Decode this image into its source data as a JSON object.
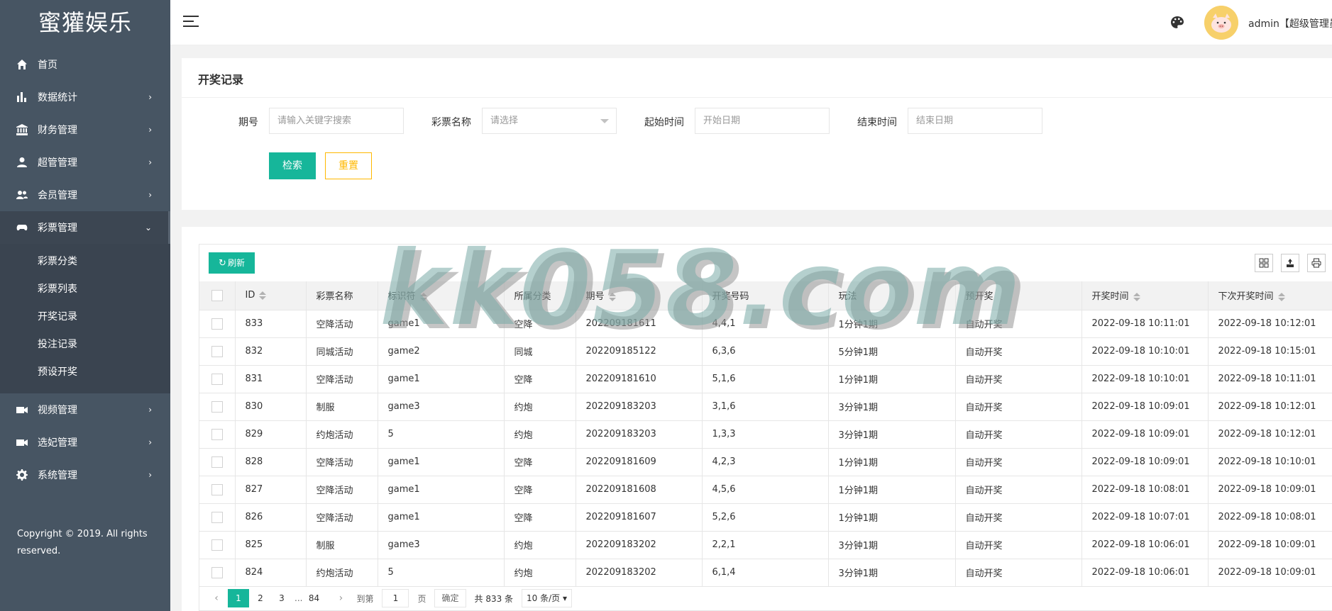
{
  "app": {
    "title": "蜜獾娱乐",
    "copyright": "Copyright © 2019. All rights reserved."
  },
  "sidebar": {
    "items": [
      {
        "label": "首页",
        "icon": "home-icon"
      },
      {
        "label": "数据统计",
        "icon": "bar-chart-icon"
      },
      {
        "label": "财务管理",
        "icon": "bank-icon"
      },
      {
        "label": "超管管理",
        "icon": "user-icon"
      },
      {
        "label": "会员管理",
        "icon": "users-icon"
      },
      {
        "label": "彩票管理",
        "icon": "gamepad-icon"
      },
      {
        "label": "视频管理",
        "icon": "video-icon"
      },
      {
        "label": "选妃管理",
        "icon": "video-icon"
      },
      {
        "label": "系统管理",
        "icon": "gear-icon"
      }
    ],
    "submenu": [
      "彩票分类",
      "彩票列表",
      "开奖记录",
      "投注记录",
      "预设开奖"
    ]
  },
  "header": {
    "user": "admin【超级管理员"
  },
  "filter": {
    "title": "开奖记录",
    "period_label": "期号",
    "period_placeholder": "请输入关键字搜索",
    "lottery_label": "彩票名称",
    "lottery_placeholder": "请选择",
    "start_label": "起始时间",
    "start_placeholder": "开始日期",
    "end_label": "结束时间",
    "end_placeholder": "结束日期",
    "search_btn": "检索",
    "reset_btn": "重置"
  },
  "table": {
    "refresh_btn": "刷新",
    "columns": [
      "ID",
      "彩票名称",
      "标识符",
      "所属分类",
      "期号",
      "开奖号码",
      "玩法",
      "预开奖",
      "开奖时间",
      "下次开奖时间"
    ],
    "rows": [
      [
        "833",
        "空降活动",
        "game1",
        "空降",
        "202209181611",
        "4,4,1",
        "1分钟1期",
        "自动开奖",
        "2022-09-18 10:11:01",
        "2022-09-18 10:12:01"
      ],
      [
        "832",
        "同城活动",
        "game2",
        "同城",
        "202209185122",
        "6,3,6",
        "5分钟1期",
        "自动开奖",
        "2022-09-18 10:10:01",
        "2022-09-18 10:15:01"
      ],
      [
        "831",
        "空降活动",
        "game1",
        "空降",
        "202209181610",
        "5,1,6",
        "1分钟1期",
        "自动开奖",
        "2022-09-18 10:10:01",
        "2022-09-18 10:11:01"
      ],
      [
        "830",
        "制服",
        "game3",
        "约炮",
        "202209183203",
        "3,1,6",
        "3分钟1期",
        "自动开奖",
        "2022-09-18 10:09:01",
        "2022-09-18 10:12:01"
      ],
      [
        "829",
        "约炮活动",
        "5",
        "约炮",
        "202209183203",
        "1,3,3",
        "3分钟1期",
        "自动开奖",
        "2022-09-18 10:09:01",
        "2022-09-18 10:12:01"
      ],
      [
        "828",
        "空降活动",
        "game1",
        "空降",
        "202209181609",
        "4,2,3",
        "1分钟1期",
        "自动开奖",
        "2022-09-18 10:09:01",
        "2022-09-18 10:10:01"
      ],
      [
        "827",
        "空降活动",
        "game1",
        "空降",
        "202209181608",
        "4,5,6",
        "1分钟1期",
        "自动开奖",
        "2022-09-18 10:08:01",
        "2022-09-18 10:09:01"
      ],
      [
        "826",
        "空降活动",
        "game1",
        "空降",
        "202209181607",
        "5,2,6",
        "1分钟1期",
        "自动开奖",
        "2022-09-18 10:07:01",
        "2022-09-18 10:08:01"
      ],
      [
        "825",
        "制服",
        "game3",
        "约炮",
        "202209183202",
        "2,2,1",
        "3分钟1期",
        "自动开奖",
        "2022-09-18 10:06:01",
        "2022-09-18 10:09:01"
      ],
      [
        "824",
        "约炮活动",
        "5",
        "约炮",
        "202209183202",
        "6,1,4",
        "3分钟1期",
        "自动开奖",
        "2022-09-18 10:06:01",
        "2022-09-18 10:09:01"
      ]
    ]
  },
  "pager": {
    "pages": [
      "1",
      "2",
      "3",
      "84"
    ],
    "ellipsis": "...",
    "goto_label": "到第",
    "goto_value": "1",
    "page_unit": "页",
    "confirm": "确定",
    "total": "共 833 条",
    "page_size": "10 条/页"
  },
  "watermark": "kk058.com",
  "colors": {
    "sidebar": "#475563",
    "primary": "#16b69a",
    "warn": "#ffb800"
  }
}
